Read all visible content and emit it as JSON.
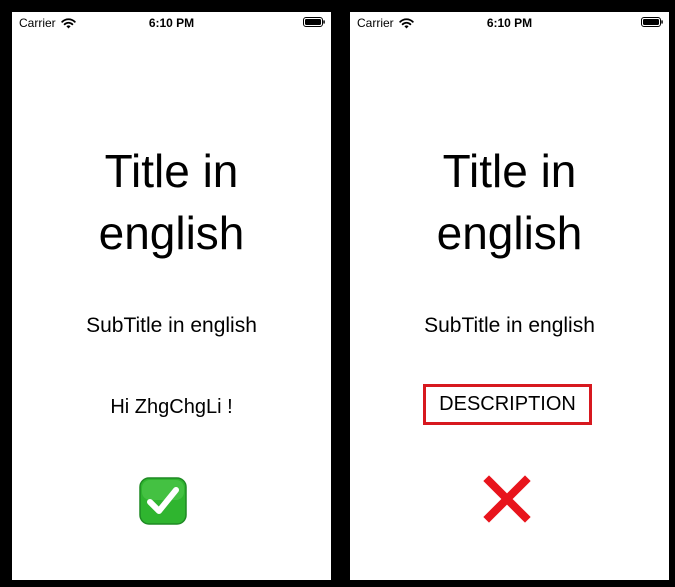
{
  "status_bar": {
    "carrier": "Carrier",
    "time": "6:10 PM"
  },
  "left_screen": {
    "title_line1": "Title in",
    "title_line2": "english",
    "subtitle": "SubTitle in english",
    "greeting": "Hi ZhgChgLi !",
    "result_icon": "check-mark-icon"
  },
  "right_screen": {
    "title_line1": "Title in",
    "title_line2": "english",
    "subtitle": "SubTitle in english",
    "description": "DESCRIPTION",
    "result_icon": "cross-mark-icon"
  },
  "colors": {
    "background": "#000000",
    "screen": "#ffffff",
    "highlight_border": "#d7181f",
    "check_green": "#2fb52f",
    "cross_red": "#e8141c"
  }
}
